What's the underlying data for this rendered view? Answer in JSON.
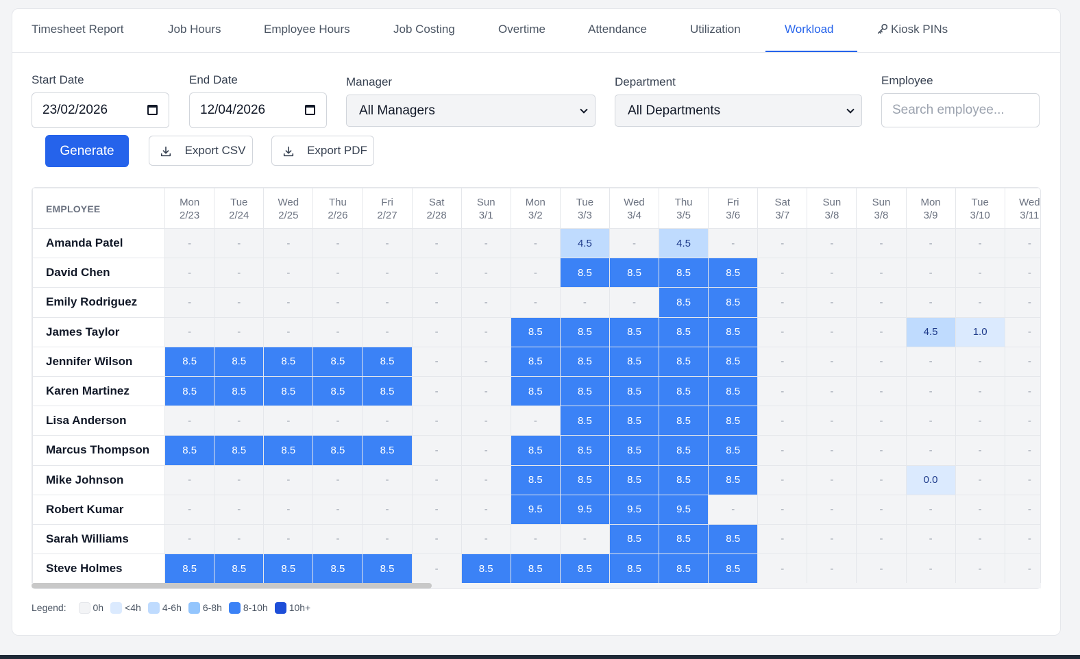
{
  "tabs": [
    {
      "label": "Timesheet Report",
      "active": false
    },
    {
      "label": "Job Hours",
      "active": false
    },
    {
      "label": "Employee Hours",
      "active": false
    },
    {
      "label": "Job Costing",
      "active": false
    },
    {
      "label": "Overtime",
      "active": false
    },
    {
      "label": "Attendance",
      "active": false
    },
    {
      "label": "Utilization",
      "active": false
    },
    {
      "label": "Workload",
      "active": true
    },
    {
      "label": "Kiosk PINs",
      "active": false,
      "icon": "key-icon"
    }
  ],
  "filters": {
    "start_date_label": "Start Date",
    "start_date_value": "23/02/2026",
    "end_date_label": "End Date",
    "end_date_value": "12/04/2026",
    "manager_label": "Manager",
    "manager_value": "All Managers",
    "department_label": "Department",
    "department_value": "All Departments",
    "employee_label": "Employee",
    "employee_placeholder": "Search employee..."
  },
  "actions": {
    "generate_label": "Generate",
    "export_csv_label": "Export CSV",
    "export_pdf_label": "Export PDF"
  },
  "grid": {
    "employee_header": "EMPLOYEE",
    "days": [
      {
        "dow": "Mon",
        "date": "2/23"
      },
      {
        "dow": "Tue",
        "date": "2/24"
      },
      {
        "dow": "Wed",
        "date": "2/25"
      },
      {
        "dow": "Thu",
        "date": "2/26"
      },
      {
        "dow": "Fri",
        "date": "2/27"
      },
      {
        "dow": "Sat",
        "date": "2/28"
      },
      {
        "dow": "Sun",
        "date": "3/1"
      },
      {
        "dow": "Mon",
        "date": "3/2"
      },
      {
        "dow": "Tue",
        "date": "3/3"
      },
      {
        "dow": "Wed",
        "date": "3/4"
      },
      {
        "dow": "Thu",
        "date": "3/5"
      },
      {
        "dow": "Fri",
        "date": "3/6"
      },
      {
        "dow": "Sat",
        "date": "3/7"
      },
      {
        "dow": "Sun",
        "date": "3/8"
      },
      {
        "dow": "Sun",
        "date": "3/8"
      },
      {
        "dow": "Mon",
        "date": "3/9"
      },
      {
        "dow": "Tue",
        "date": "3/10"
      },
      {
        "dow": "Wed",
        "date": "3/11"
      }
    ],
    "rows": [
      {
        "name": "Amanda Patel",
        "cells": [
          "-",
          "-",
          "-",
          "-",
          "-",
          "-",
          "-",
          "-",
          "4.5",
          "-",
          "4.5",
          "-",
          "-",
          "-",
          "-",
          "-",
          "-",
          "-"
        ]
      },
      {
        "name": "David Chen",
        "cells": [
          "-",
          "-",
          "-",
          "-",
          "-",
          "-",
          "-",
          "-",
          "8.5",
          "8.5",
          "8.5",
          "8.5",
          "-",
          "-",
          "-",
          "-",
          "-",
          "-"
        ]
      },
      {
        "name": "Emily Rodriguez",
        "cells": [
          "-",
          "-",
          "-",
          "-",
          "-",
          "-",
          "-",
          "-",
          "-",
          "-",
          "8.5",
          "8.5",
          "-",
          "-",
          "-",
          "-",
          "-",
          "-"
        ]
      },
      {
        "name": "James Taylor",
        "cells": [
          "-",
          "-",
          "-",
          "-",
          "-",
          "-",
          "-",
          "8.5",
          "8.5",
          "8.5",
          "8.5",
          "8.5",
          "-",
          "-",
          "-",
          "4.5",
          "1.0",
          "-"
        ]
      },
      {
        "name": "Jennifer Wilson",
        "cells": [
          "8.5",
          "8.5",
          "8.5",
          "8.5",
          "8.5",
          "-",
          "-",
          "8.5",
          "8.5",
          "8.5",
          "8.5",
          "8.5",
          "-",
          "-",
          "-",
          "-",
          "-",
          "-"
        ]
      },
      {
        "name": "Karen Martinez",
        "cells": [
          "8.5",
          "8.5",
          "8.5",
          "8.5",
          "8.5",
          "-",
          "-",
          "8.5",
          "8.5",
          "8.5",
          "8.5",
          "8.5",
          "-",
          "-",
          "-",
          "-",
          "-",
          "-"
        ]
      },
      {
        "name": "Lisa Anderson",
        "cells": [
          "-",
          "-",
          "-",
          "-",
          "-",
          "-",
          "-",
          "-",
          "8.5",
          "8.5",
          "8.5",
          "8.5",
          "-",
          "-",
          "-",
          "-",
          "-",
          "-"
        ]
      },
      {
        "name": "Marcus Thompson",
        "cells": [
          "8.5",
          "8.5",
          "8.5",
          "8.5",
          "8.5",
          "-",
          "-",
          "8.5",
          "8.5",
          "8.5",
          "8.5",
          "8.5",
          "-",
          "-",
          "-",
          "-",
          "-",
          "-"
        ]
      },
      {
        "name": "Mike Johnson",
        "cells": [
          "-",
          "-",
          "-",
          "-",
          "-",
          "-",
          "-",
          "8.5",
          "8.5",
          "8.5",
          "8.5",
          "8.5",
          "-",
          "-",
          "-",
          "0.0",
          "-",
          "-"
        ]
      },
      {
        "name": "Robert Kumar",
        "cells": [
          "-",
          "-",
          "-",
          "-",
          "-",
          "-",
          "-",
          "9.5",
          "9.5",
          "9.5",
          "9.5",
          "-",
          "-",
          "-",
          "-",
          "-",
          "-",
          "-"
        ]
      },
      {
        "name": "Sarah Williams",
        "cells": [
          "-",
          "-",
          "-",
          "-",
          "-",
          "-",
          "-",
          "-",
          "-",
          "8.5",
          "8.5",
          "8.5",
          "-",
          "-",
          "-",
          "-",
          "-",
          "-"
        ]
      },
      {
        "name": "Steve Holmes",
        "cells": [
          "8.5",
          "8.5",
          "8.5",
          "8.5",
          "8.5",
          "-",
          "8.5",
          "8.5",
          "8.5",
          "8.5",
          "8.5",
          "8.5",
          "-",
          "-",
          "-",
          "-",
          "-",
          "-"
        ]
      }
    ]
  },
  "legend": {
    "label": "Legend:",
    "items": [
      {
        "label": "0h",
        "color": "#f3f4f6"
      },
      {
        "label": "<4h",
        "color": "#dbeafe"
      },
      {
        "label": "4-6h",
        "color": "#bfdbfe"
      },
      {
        "label": "6-8h",
        "color": "#93c5fd"
      },
      {
        "label": "8-10h",
        "color": "#3b82f6"
      },
      {
        "label": "10h+",
        "color": "#1d4ed8"
      }
    ]
  },
  "colors": {
    "accent": "#2563eb",
    "cell_8_10h": "#3b82f6",
    "cell_4_6h": "#bfdbfe",
    "cell_lt4h": "#dbeafe",
    "cell_0h": "#f3f4f6"
  }
}
